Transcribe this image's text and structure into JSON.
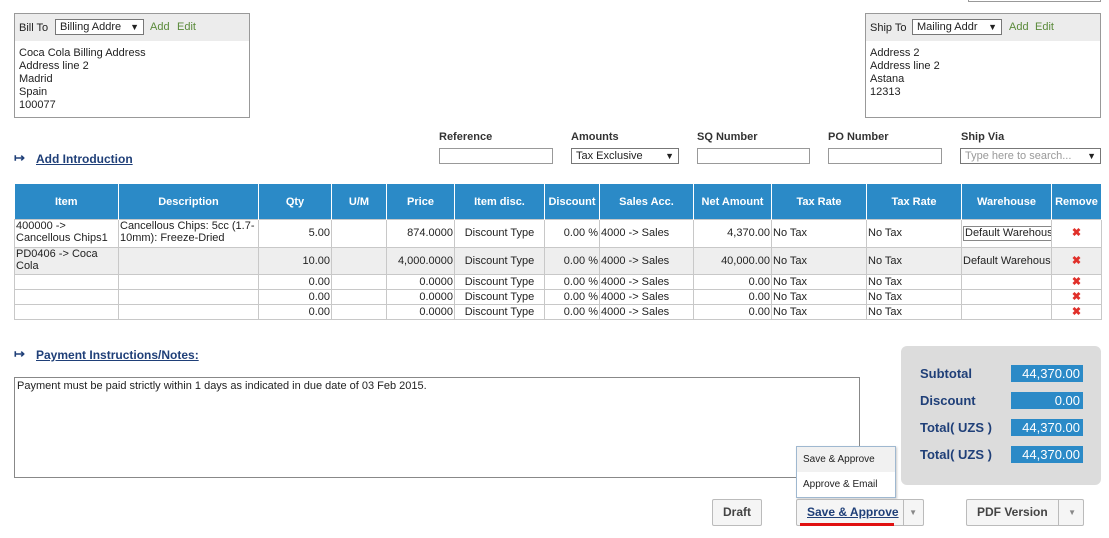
{
  "bill_to": {
    "label": "Bill To",
    "select_value": "Billing Addre",
    "add": "Add",
    "edit": "Edit",
    "address": "Coca Cola Billing Address\nAddress line 2\nMadrid\nSpain\n100077"
  },
  "ship_to": {
    "label": "Ship To",
    "select_value": "Mailing Addr",
    "add": "Add",
    "edit": "Edit",
    "address": "Address 2\nAddress line 2\nAstana\n12313"
  },
  "header_fields": {
    "reference_label": "Reference",
    "amounts_label": "Amounts",
    "amounts_value": "Tax Exclusive",
    "sq_label": "SQ Number",
    "po_label": "PO Number",
    "ship_via_label": "Ship Via",
    "ship_via_placeholder": "Type here to search..."
  },
  "add_introduction": "Add Introduction",
  "table": {
    "columns": [
      "Item",
      "Description",
      "Qty",
      "U/M",
      "Price",
      "Item disc.",
      "Discount",
      "Sales Acc.",
      "Net Amount",
      "Tax Rate",
      "Tax Rate",
      "Warehouse",
      "Remove"
    ],
    "rows": [
      {
        "item": "400000 -> Cancellous Chips1",
        "description": "Cancellous Chips: 5cc (1.7-10mm): Freeze-Dried",
        "qty": "5.00",
        "um": "",
        "price": "874.0000",
        "item_disc": "Discount Type",
        "discount": "0.00 %",
        "sales_acc": "4000 -> Sales",
        "net_amount": "4,370.00",
        "tax_rate1": "No Tax",
        "tax_rate2": "No Tax",
        "warehouse": "Default Warehouse"
      },
      {
        "item": "PD0406 -> Coca Cola",
        "description": "",
        "qty": "10.00",
        "um": "",
        "price": "4,000.0000",
        "item_disc": "Discount Type",
        "discount": "0.00 %",
        "sales_acc": "4000 -> Sales",
        "net_amount": "40,000.00",
        "tax_rate1": "No Tax",
        "tax_rate2": "No Tax",
        "warehouse": "Default Warehouse"
      },
      {
        "item": "",
        "description": "",
        "qty": "0.00",
        "um": "",
        "price": "0.0000",
        "item_disc": "Discount Type",
        "discount": "0.00 %",
        "sales_acc": "4000 -> Sales",
        "net_amount": "0.00",
        "tax_rate1": "No Tax",
        "tax_rate2": "No Tax",
        "warehouse": ""
      },
      {
        "item": "",
        "description": "",
        "qty": "0.00",
        "um": "",
        "price": "0.0000",
        "item_disc": "Discount Type",
        "discount": "0.00 %",
        "sales_acc": "4000 -> Sales",
        "net_amount": "0.00",
        "tax_rate1": "No Tax",
        "tax_rate2": "No Tax",
        "warehouse": ""
      },
      {
        "item": "",
        "description": "",
        "qty": "0.00",
        "um": "",
        "price": "0.0000",
        "item_disc": "Discount Type",
        "discount": "0.00 %",
        "sales_acc": "4000 -> Sales",
        "net_amount": "0.00",
        "tax_rate1": "No Tax",
        "tax_rate2": "No Tax",
        "warehouse": ""
      }
    ],
    "remove_icon": "close-icon"
  },
  "payment_instructions": {
    "label": "Payment Instructions/Notes:",
    "text": "Payment must be paid strictly within 1 days as indicated in due date of 03 Feb 2015."
  },
  "totals": {
    "subtotal_label": "Subtotal",
    "subtotal_value": "44,370.00",
    "discount_label": "Discount",
    "discount_value": "0.00",
    "total1_label": "Total( UZS )",
    "total1_value": "44,370.00",
    "total2_label": "Total( UZS )",
    "total2_value": "44,370.00"
  },
  "save_menu": {
    "item1": "Save & Approve",
    "item2": "Approve & Email"
  },
  "buttons": {
    "draft": "Draft",
    "save_approve": "Save & Approve",
    "pdf_version": "PDF Version"
  },
  "colors": {
    "table_header": "#2b8ac7",
    "link": "#1f3f78",
    "remove_icon": "#e0302a",
    "underline_red": "#e01010"
  }
}
